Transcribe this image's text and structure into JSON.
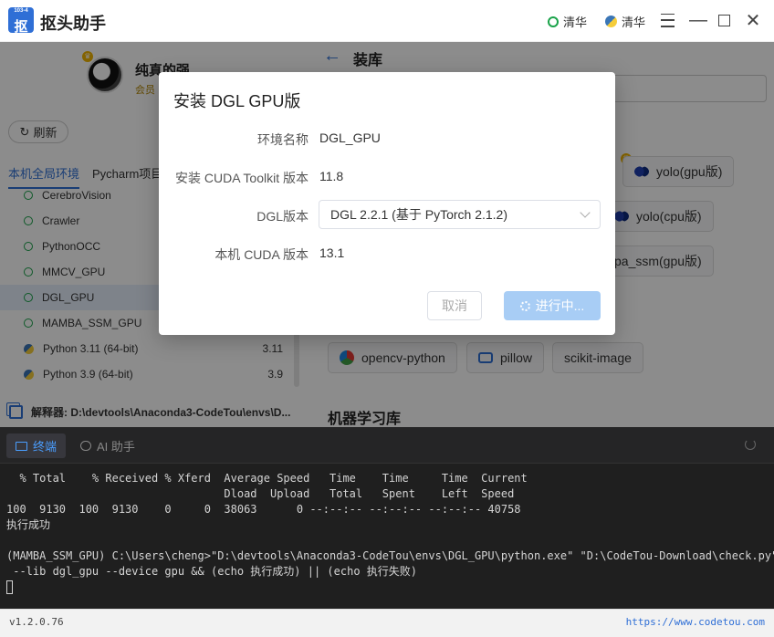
{
  "app": {
    "logo_small": "103-4",
    "logo_big": "抠",
    "title": "抠头助手",
    "mirrors": [
      "清华",
      "清华"
    ]
  },
  "user": {
    "name": "纯真的强",
    "level": "会员"
  },
  "left": {
    "refresh_label": "刷新",
    "tabs": [
      "本机全局环境",
      "Pycharm项目"
    ],
    "envs": [
      {
        "name": "CerebroVision",
        "type": "conda"
      },
      {
        "name": "Crawler",
        "type": "conda"
      },
      {
        "name": "PythonOCC",
        "type": "conda"
      },
      {
        "name": "MMCV_GPU",
        "type": "conda"
      },
      {
        "name": "DGL_GPU",
        "type": "conda",
        "selected": true
      },
      {
        "name": "MAMBA_SSM_GPU",
        "type": "conda"
      },
      {
        "name": "Python 3.11 (64-bit)",
        "type": "python",
        "version": "3.11"
      },
      {
        "name": "Python 3.9 (64-bit)",
        "type": "python",
        "version": "3.9"
      }
    ],
    "interpreter": "解释器: D:\\devtools\\Anaconda3-CodeTou\\envs\\D..."
  },
  "right": {
    "title": "装库",
    "packages": {
      "yolo_gpu": "yolo(gpu版)",
      "yolo_cpu": "yolo(cpu版)",
      "mamba_ssm": "pa_ssm(gpu版)",
      "opencv": "opencv-python",
      "pillow": "pillow",
      "scikit": "scikit-image"
    },
    "section_ml": "机器学习库"
  },
  "dialog": {
    "title": "安装 DGL GPU版",
    "env_label": "环境名称",
    "env_value": "DGL_GPU",
    "cuda_toolkit_label": "安装 CUDA Toolkit 版本",
    "cuda_toolkit_value": "11.8",
    "dgl_label": "DGL版本",
    "dgl_value": "DGL 2.2.1 (基于 PyTorch 2.1.2)",
    "local_cuda_label": "本机 CUDA 版本",
    "local_cuda_value": "13.1",
    "cancel_label": "取消",
    "progress_label": "进行中..."
  },
  "terminal": {
    "tab_terminal": "终端",
    "tab_ai": "AI 助手",
    "lines": [
      "  % Total    % Received % Xferd  Average Speed   Time    Time     Time  Current",
      "                                 Dload  Upload   Total   Spent    Left  Speed",
      "100  9130  100  9130    0     0  38063      0 --:--:-- --:--:-- --:--:-- 40758",
      "执行成功",
      "",
      "(MAMBA_SSM_GPU) C:\\Users\\cheng>\"D:\\devtools\\Anaconda3-CodeTou\\envs\\DGL_GPU\\python.exe\" \"D:\\CodeTou-Download\\check.py\"",
      " --lib dgl_gpu --device gpu && (echo 执行成功) || (echo 执行失败)"
    ]
  },
  "statusbar": {
    "version": "v1.2.0.76",
    "link": "https://www.codetou.com"
  },
  "colors": {
    "accent": "#2f6fd6",
    "conda_ring": "#1aa34a",
    "terminal_bg": "#1f1f1f"
  }
}
